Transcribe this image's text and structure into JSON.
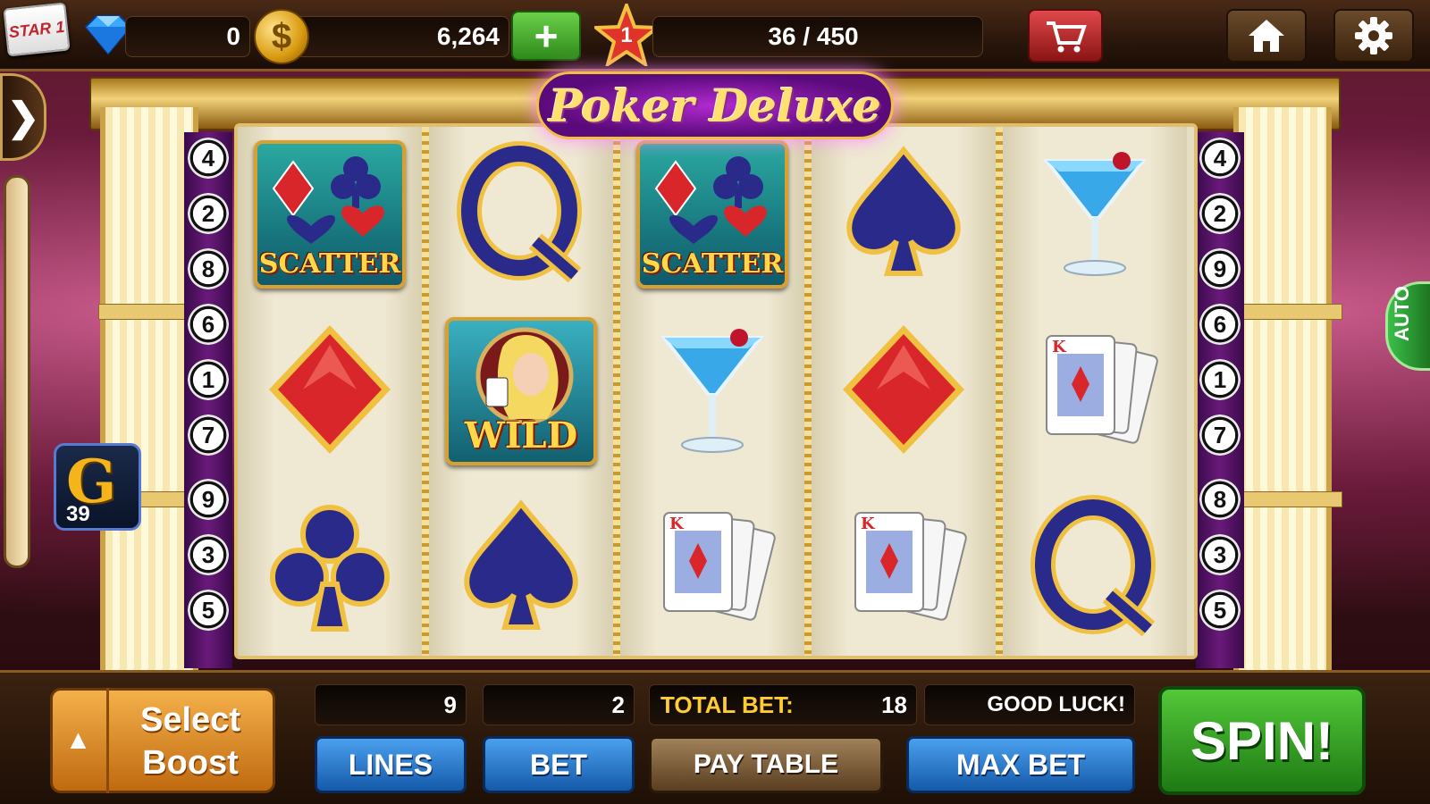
{
  "topbar": {
    "star_badge": "STAR 1",
    "gems": "0",
    "coins": "6,264",
    "plus_label": "+",
    "level": "1",
    "level_progress": "36 / 450",
    "icons": [
      "gem-icon",
      "coin-icon",
      "star-icon",
      "cart-icon",
      "home-icon",
      "gear-icon"
    ]
  },
  "game": {
    "title": "Poker Deluxe",
    "side_arrow": "❯",
    "boost_badge": {
      "letter": "G",
      "count": "39"
    },
    "auto_label": "AUTO",
    "paylines_left": [
      "4",
      "2",
      "8",
      "6",
      "1",
      "7",
      "9",
      "3",
      "5"
    ],
    "paylines_right": [
      "4",
      "2",
      "9",
      "6",
      "1",
      "7",
      "8",
      "3",
      "5"
    ],
    "reels": [
      [
        "scatter",
        "diamond",
        "club"
      ],
      [
        "queen",
        "wild",
        "spade"
      ],
      [
        "scatter",
        "martini",
        "kings"
      ],
      [
        "spade",
        "diamond",
        "kings"
      ],
      [
        "martini",
        "kings",
        "queen"
      ]
    ],
    "symbol_labels": {
      "scatter": "SCATTER",
      "wild": "WILD",
      "queen": "Q",
      "kings": "K"
    }
  },
  "controls": {
    "boost_arrow": "▲",
    "boost_label_1": "Select",
    "boost_label_2": "Boost",
    "lines_value": "9",
    "bet_value": "2",
    "total_bet_label": "TOTAL BET:",
    "total_bet_value": "18",
    "message": "GOOD LUCK!",
    "lines_button": "LINES",
    "bet_button": "BET",
    "paytable_button": "PAY TABLE",
    "maxbet_button": "MAX BET",
    "spin_button": "SPIN!"
  },
  "colors": {
    "accent_gold": "#f0c040",
    "spin_green": "#2f8a1a",
    "button_blue": "#155aaa",
    "red_suit": "#d8262a",
    "blue_suit": "#2a2a8a"
  }
}
